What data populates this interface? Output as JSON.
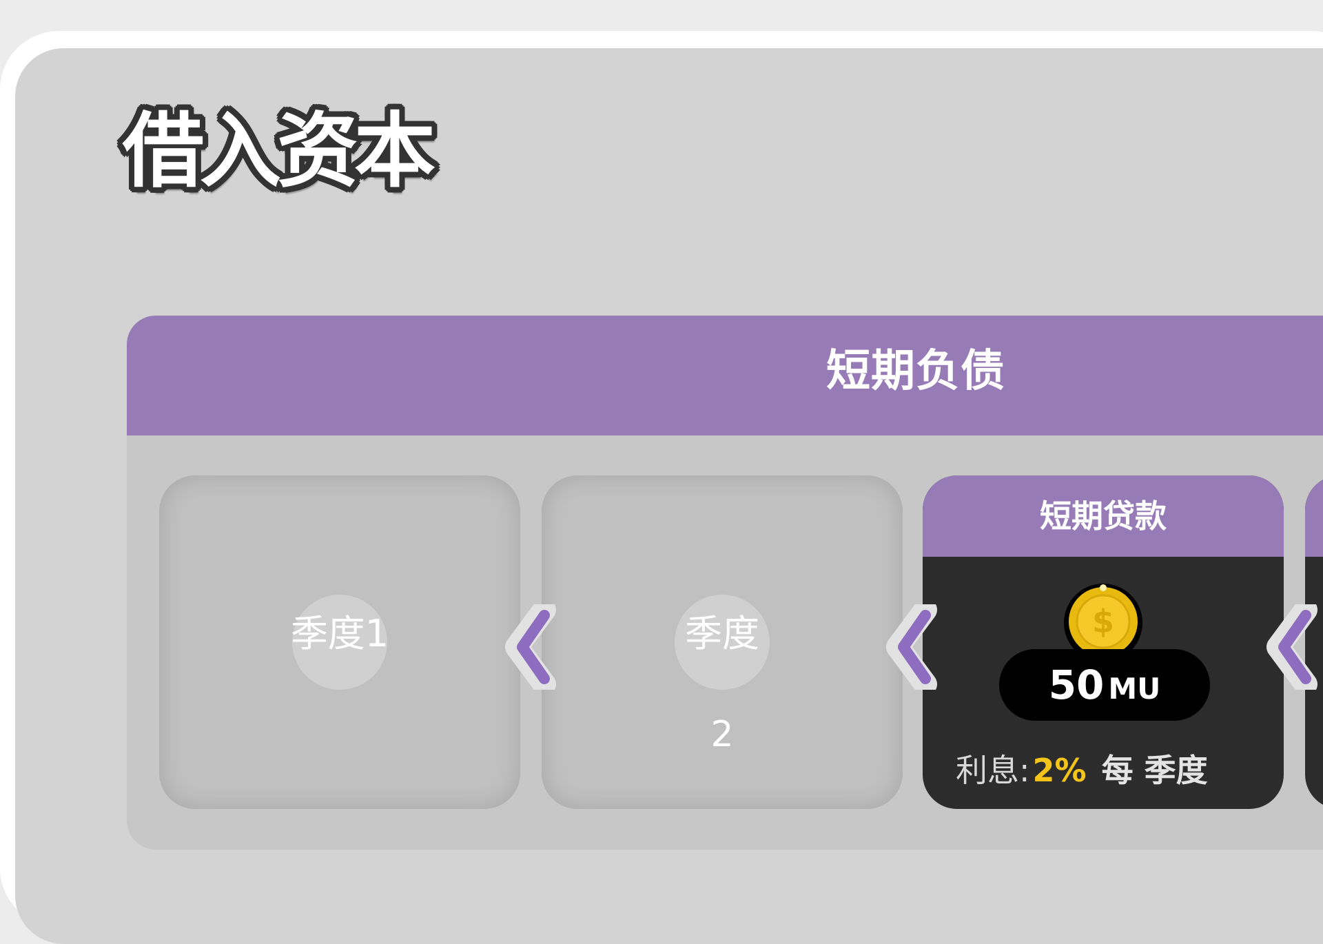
{
  "page": {
    "title": "借入资本"
  },
  "section": {
    "title": "短期负债"
  },
  "slots": [
    {
      "label": "季度1",
      "number": ""
    },
    {
      "label": "季度",
      "number": "2"
    }
  ],
  "loan_card": {
    "title": "短期贷款",
    "amount": "50",
    "unit": "MU",
    "interest_label": "利息:",
    "interest_value": "2%",
    "interest_period": "每 季度"
  },
  "icons": {
    "coin": "dollar-coin-icon",
    "arrow": "chevron-left-icon"
  },
  "colors": {
    "accent_purple": "#967bb6",
    "card_dark": "#2c2c2c",
    "interest_yellow": "#f5c41b",
    "coin_gold": "#f2c318"
  }
}
